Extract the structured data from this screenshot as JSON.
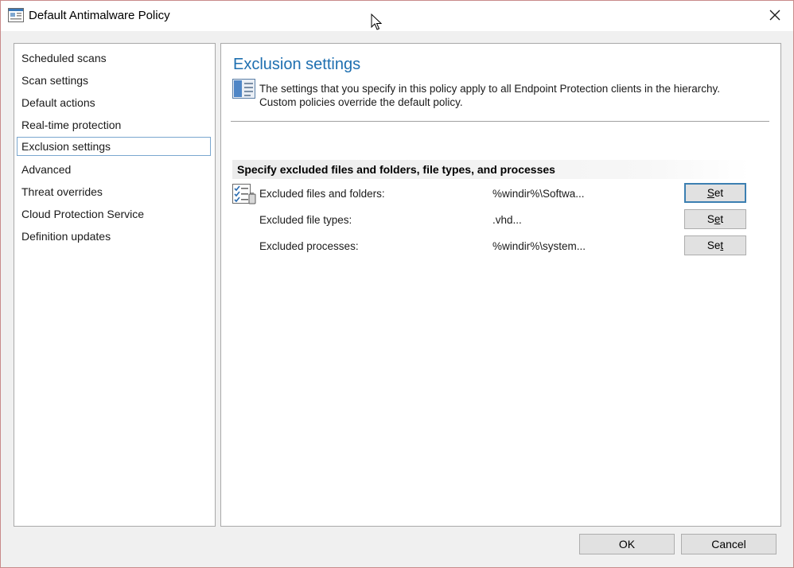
{
  "window": {
    "title": "Default Antimalware Policy",
    "close_glyph": "✕"
  },
  "sidebar": {
    "items": [
      {
        "label": "Scheduled scans"
      },
      {
        "label": "Scan settings"
      },
      {
        "label": "Default actions"
      },
      {
        "label": "Real-time protection"
      },
      {
        "label": "Exclusion settings",
        "selected": true
      },
      {
        "label": "Advanced"
      },
      {
        "label": "Threat overrides"
      },
      {
        "label": "Cloud Protection Service"
      },
      {
        "label": "Definition updates"
      }
    ]
  },
  "main": {
    "title": "Exclusion settings",
    "info_line1": "The settings that you specify in this policy apply to all Endpoint Protection clients in the hierarchy.",
    "info_line2": "Custom policies override the default policy.",
    "section_header": "Specify excluded files and folders, file types, and processes",
    "rows": [
      {
        "label": "Excluded files and folders:",
        "value": "%windir%\\Softwa...",
        "button": "Set",
        "button_accel": "S",
        "button_rest": "et"
      },
      {
        "label": "Excluded file types:",
        "value": ".vhd...",
        "button": "Set",
        "button_pre": "S",
        "button_accel": "e",
        "button_rest": "t"
      },
      {
        "label": "Excluded processes:",
        "value": "%windir%\\system...",
        "button": "Set",
        "button_pre": "Se",
        "button_accel": "t",
        "button_rest": ""
      }
    ]
  },
  "footer": {
    "ok_label": "OK",
    "cancel_label": "Cancel"
  },
  "colors": {
    "title_blue": "#1e6fb0",
    "selection_border": "#7aa7cf",
    "default_button_border": "#3c7fb1"
  },
  "icons": [
    "window-app-icon",
    "close-icon",
    "mouse-cursor-icon",
    "policy-info-icon",
    "checklist-icon"
  ]
}
